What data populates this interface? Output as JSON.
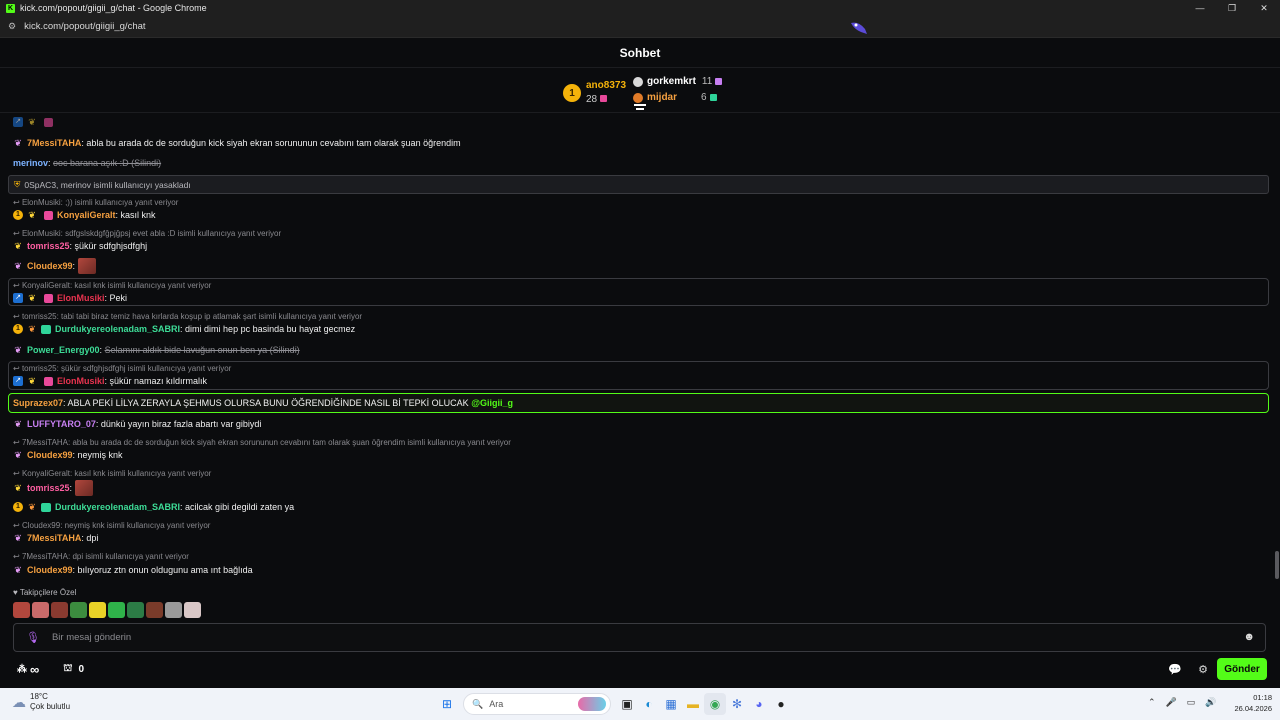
{
  "window": {
    "title": "kick.com/popout/giigii_g/chat - Google Chrome",
    "minimize": "—",
    "maximize": "❐",
    "close": "✕"
  },
  "browser": {
    "url": "kick.com/popout/giigii_g/chat"
  },
  "chat": {
    "title": "Sohbet"
  },
  "leaderboard": {
    "first": {
      "rank": "1",
      "name": "ano8373",
      "count": "28"
    },
    "second": {
      "name": "gorkemkrt",
      "count": "11"
    },
    "third": {
      "name": "mijdar",
      "count": "6"
    }
  },
  "messages": {
    "m0": {
      "user": "7MessiTAHA",
      "text": ": abla bu arada dc de sorduğun kick siyah ekran sorununun cevabını tam olarak şuan öğrendim"
    },
    "m1": {
      "user": "merinov",
      "text": "ooc barana aşık :D (Silindi)"
    },
    "sys1": {
      "text": "0SpAC3, merinov isimli kullanıcıyı yasakladı"
    },
    "r2": {
      "text": "ElonMusiki: ;)) isimli kullanıcıya yanıt veriyor"
    },
    "m2": {
      "user": "KonyaliGeralt",
      "text": ": kasıl knk"
    },
    "r3": {
      "text": "ElonMusiki: sdfgslskdgfğpjğpsj evet abla :D isimli kullanıcıya yanıt veriyor"
    },
    "m3": {
      "user": "tomriss25",
      "text": ": şükür sdfghjsdfghj"
    },
    "m4": {
      "user": "Cloudex99",
      "text": ":"
    },
    "r5": {
      "text": "KonyaliGeralt: kasıl knk isimli kullanıcıya yanıt veriyor"
    },
    "m5": {
      "user": "ElonMusiki",
      "text": ": Peki"
    },
    "r6": {
      "text": "tomriss25: tabi tabi biraz temiz hava kırlarda koşup ip atlamak şart isimli kullanıcıya yanıt veriyor"
    },
    "m6": {
      "user": "Durdukyereolenadam_SABRI",
      "text": ": dimi dimi hep pc basinda bu hayat gecmez"
    },
    "m7": {
      "user": "Power_Energy00",
      "text": "Selamını aldık bide lavuğun onun ben ya (Silindi)"
    },
    "r8": {
      "text": "tomriss25: şükür sdfghjsdfghj isimli kullanıcıya yanıt veriyor"
    },
    "m8": {
      "user": "ElonMusiki",
      "text": ": şükür namazı kıldırmalık"
    },
    "m9": {
      "user": "Suprazex07",
      "text": ": ABLA PEKİ LİLYA ZERAYLA ŞEHMUS OLURSA BUNU ÖĞRENDİĞİNDE NASIL Bİ TEPKİ OLUCAK",
      "mention": "@Giigii_g"
    },
    "m10": {
      "user": "LUFFYTARO_07",
      "text": ": dünkü yayın biraz fazla abartı var gibiydi"
    },
    "r11": {
      "text": "7MessiTAHA: abla bu arada dc de sorduğun kick siyah ekran sorununun cevabını tam olarak şuan öğrendim isimli kullanıcıya yanıt veriyor"
    },
    "m11": {
      "user": "Cloudex99",
      "text": ": neymiş knk"
    },
    "r12": {
      "text": "KonyaliGeralt: kasıl knk isimli kullanıcıya yanıt veriyor"
    },
    "m12": {
      "user": "tomriss25",
      "text": ":"
    },
    "m13": {
      "user": "Durdukyereolenadam_SABRI",
      "text": ": acilcak gibi degildi zaten ya"
    },
    "r14": {
      "text": "Cloudex99: neymiş knk isimli kullanıcıya yanıt veriyor"
    },
    "m14": {
      "user": "7MessiTAHA",
      "text": ": dpi"
    },
    "r15": {
      "text": "7MessiTAHA: dpi isimli kullanıcıya yanıt veriyor"
    },
    "m15": {
      "user": "Cloudex99",
      "text": ": bılıyoruz ztn onun oldugunu ama ınt bağlıda"
    }
  },
  "followers_only": {
    "label": "Takipçilere Özel"
  },
  "input": {
    "placeholder": "Bir mesaj gönderin"
  },
  "bottom": {
    "infinity": "∞",
    "gift_count": "0",
    "send": "Gönder"
  },
  "taskbar": {
    "temperature": "18°C",
    "weather": "Çok bulutlu",
    "search": "Ara",
    "time": "01:18",
    "date": "26.04.2026"
  },
  "colors": {
    "kick_green": "#53fc18",
    "gold": "#f5b30a"
  }
}
